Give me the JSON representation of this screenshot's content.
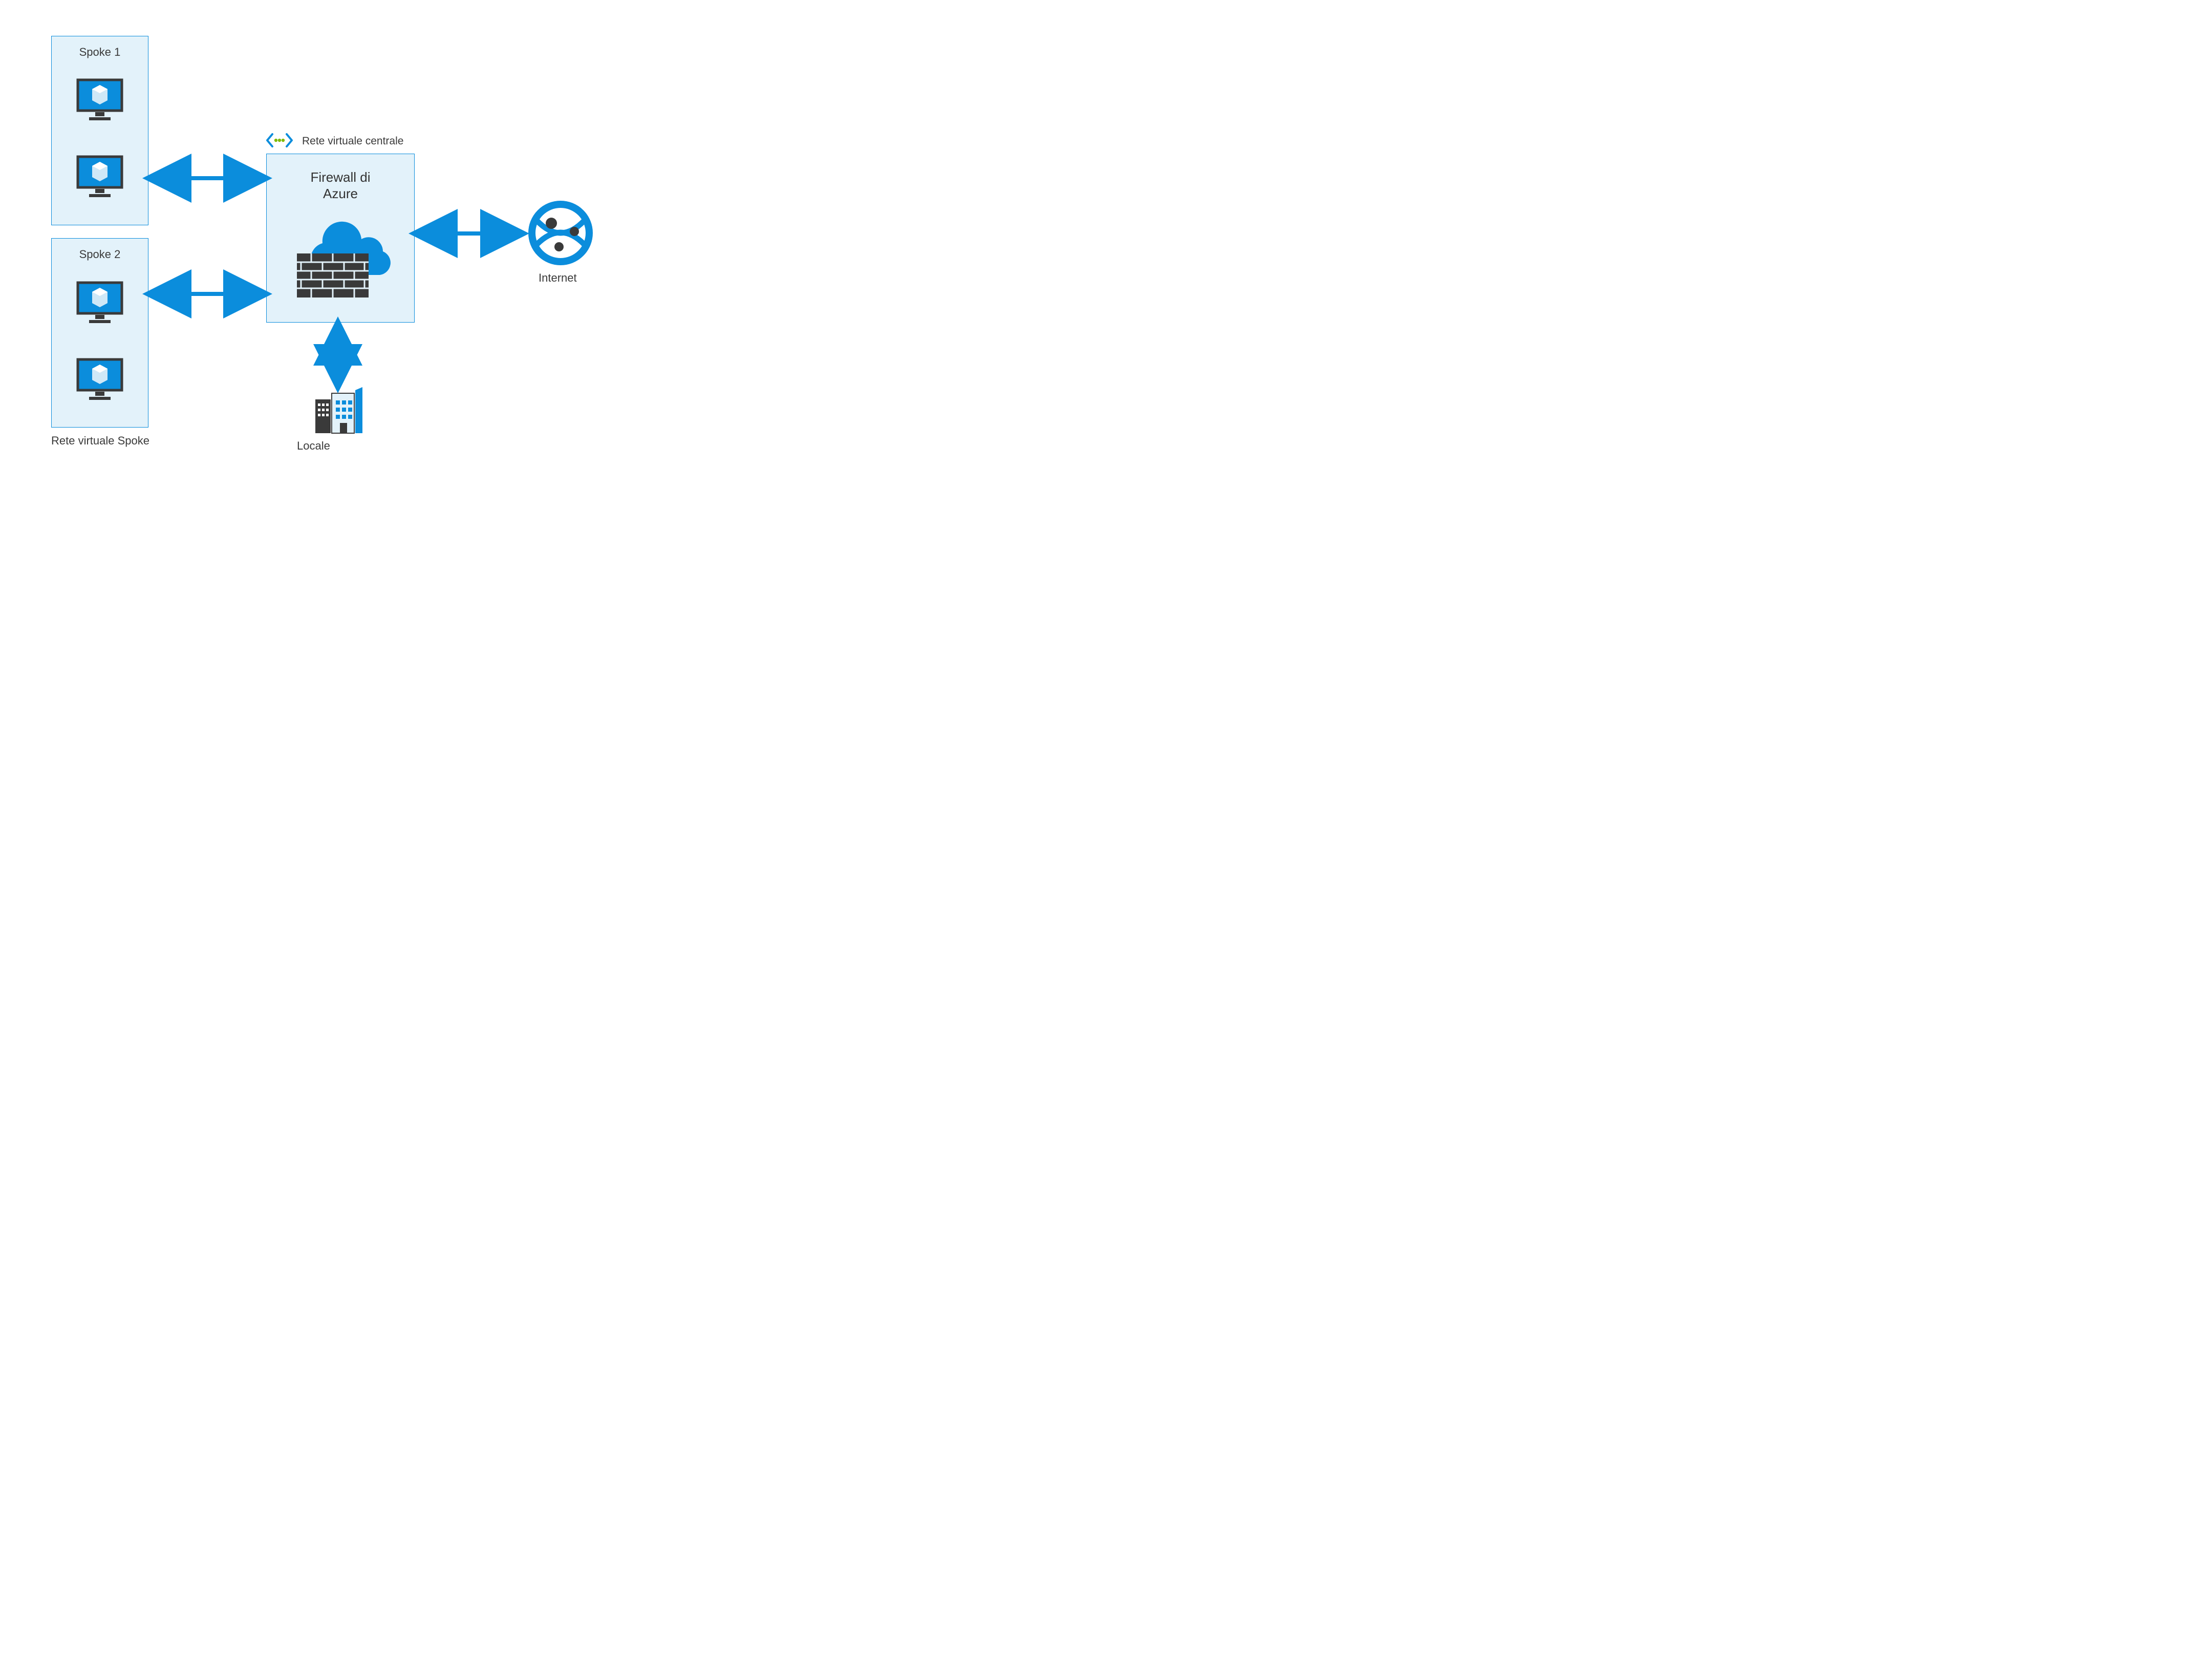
{
  "spoke1": {
    "title": "Spoke 1"
  },
  "spoke2": {
    "title": "Spoke 2"
  },
  "spokeVnetLabel": "Rete virtuale Spoke",
  "hub": {
    "vnetLabel": "Rete virtuale centrale",
    "firewallLine1": "Firewall di",
    "firewallLine2": "Azure"
  },
  "onprem": {
    "label": "Locale"
  },
  "internet": {
    "label": "Internet"
  },
  "colors": {
    "azureBlue": "#0b8ddc",
    "lightBlue": "#e3f2fa",
    "dark": "#3a3a3a",
    "green": "#7fba00"
  }
}
